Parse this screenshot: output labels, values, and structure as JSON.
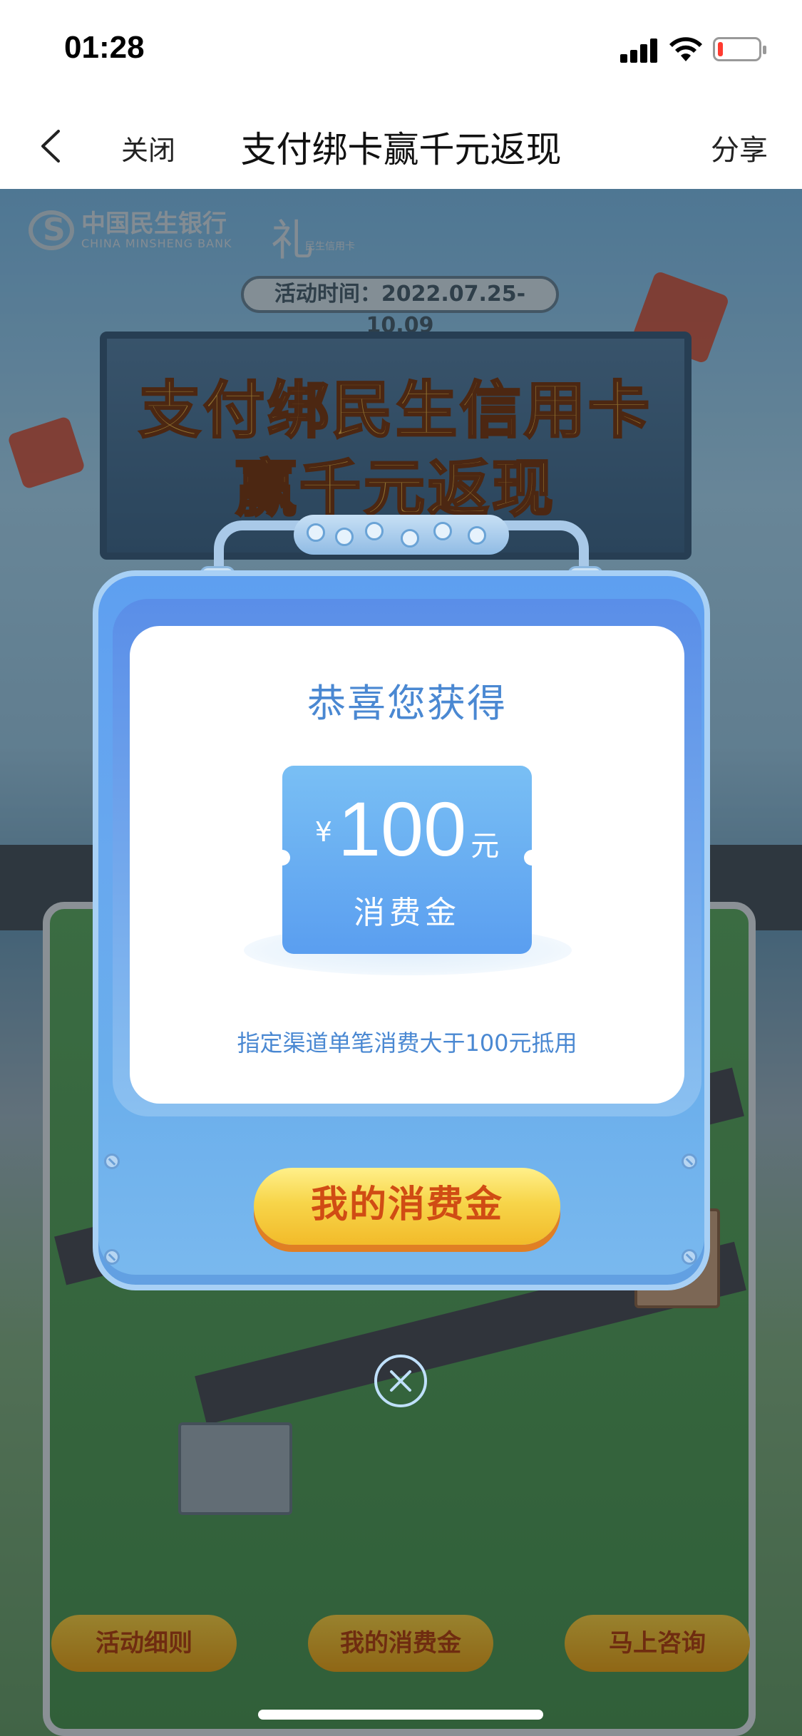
{
  "status_bar": {
    "time": "01:28",
    "icons": [
      "signal-icon",
      "wifi-icon",
      "battery-icon"
    ],
    "battery_level": 0.12
  },
  "nav": {
    "back_icon": "chevron-left-icon",
    "close_label": "关闭",
    "title": "支付绑卡赢千元返现",
    "share_label": "分享"
  },
  "background": {
    "bank_name_cn": "中国民生银行",
    "bank_name_en": "CHINA MINSHENG BANK",
    "card_brand": "礼",
    "card_brand_sub": "民生信用卡",
    "activity_time": "活动时间：2022.07.25-10.09",
    "hero_line_1": "支付绑民生信用卡",
    "hero_line_2": "赢千元返现",
    "bottom_buttons": [
      "活动细则",
      "我的消费金",
      "马上咨询"
    ]
  },
  "dialog": {
    "title": "恭喜您获得",
    "coupon": {
      "currency": "¥",
      "amount": "100",
      "unit": "元",
      "label": "消费金"
    },
    "note": "指定渠道单笔消费大于100元抵用",
    "button_label": "我的消费金",
    "close_icon": "close-circle-icon"
  },
  "colors": {
    "dialog_blue": "#5e9ff0",
    "text_blue": "#4a88d2",
    "button_yellow": "#f7d54a",
    "button_text": "#d04c14"
  }
}
